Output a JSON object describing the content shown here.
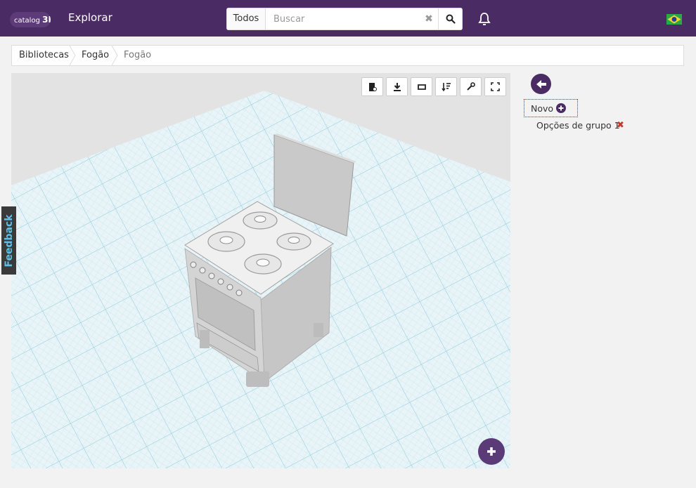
{
  "header": {
    "logo_text": "catalog",
    "logo_num": "3D",
    "nav_label": "Explorar",
    "search": {
      "scope_label": "Todos",
      "placeholder": "Buscar",
      "value": ""
    },
    "icons": [
      "search-icon",
      "close-icon",
      "bell-icon",
      "brazil-flag-icon"
    ]
  },
  "breadcrumb": [
    "Bibliotecas",
    "Fogão",
    "Fogão"
  ],
  "viewer": {
    "toolbar_icons": [
      "screenshot-icon",
      "download-icon",
      "rotate-icon",
      "sort-icon",
      "wrench-icon",
      "fullscreen-icon"
    ],
    "add_icon": "plus-icon"
  },
  "feedback_label": "Feedback",
  "panel": {
    "novo_label": "Novo",
    "groups": [
      {
        "label": "Opções de grupo 1"
      }
    ]
  },
  "colors": {
    "header_bg": "#4b2b63",
    "accent": "#5b3a78",
    "grid": "#9fd3e3",
    "delete": "#c0392b"
  }
}
